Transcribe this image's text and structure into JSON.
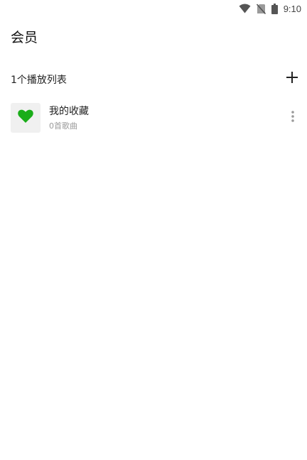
{
  "status_bar": {
    "time": "9:10",
    "icons": [
      "wifi-icon",
      "no-sim-icon",
      "battery-icon"
    ]
  },
  "page": {
    "title": "会员"
  },
  "playlists_section": {
    "count_label": "1个播放列表",
    "add_icon": "plus-icon"
  },
  "playlists": [
    {
      "title": "我的收藏",
      "subtitle": "0首歌曲",
      "cover_icon": "heart-icon",
      "menu_icon": "more-vertical-icon"
    }
  ],
  "colors": {
    "accent": "#1aad19",
    "cover_bg": "#f0f0f0",
    "subtitle": "#9a9a9a",
    "icon_gray": "#555555"
  }
}
